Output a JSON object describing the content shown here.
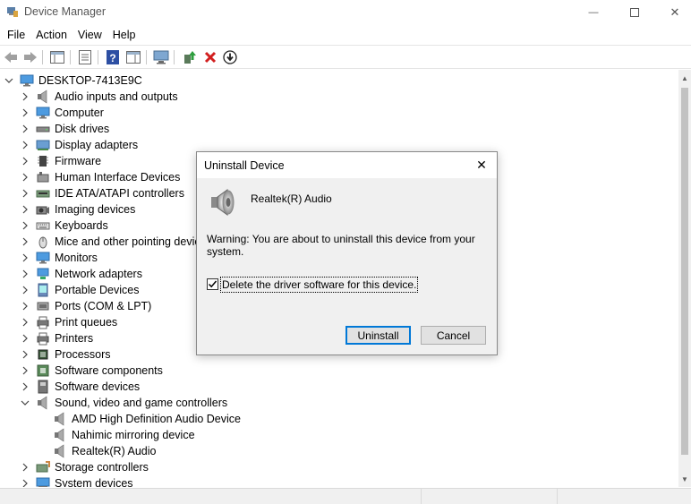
{
  "window": {
    "title": "Device Manager",
    "min_glyph": "—",
    "close_glyph": "✕"
  },
  "menu": [
    "File",
    "Action",
    "View",
    "Help"
  ],
  "tree": {
    "root": "DESKTOP-7413E9C",
    "categories": [
      {
        "label": "Audio inputs and outputs",
        "icon": "speaker-icon",
        "expanded": false
      },
      {
        "label": "Computer",
        "icon": "monitor-icon",
        "expanded": false
      },
      {
        "label": "Disk drives",
        "icon": "disk-icon",
        "expanded": false
      },
      {
        "label": "Display adapters",
        "icon": "display-adapter-icon",
        "expanded": false
      },
      {
        "label": "Firmware",
        "icon": "chip-icon",
        "expanded": false
      },
      {
        "label": "Human Interface Devices",
        "icon": "hid-icon",
        "expanded": false
      },
      {
        "label": "IDE ATA/ATAPI controllers",
        "icon": "ide-icon",
        "expanded": false
      },
      {
        "label": "Imaging devices",
        "icon": "camera-icon",
        "expanded": false
      },
      {
        "label": "Keyboards",
        "icon": "keyboard-icon",
        "expanded": false
      },
      {
        "label": "Mice and other pointing devices",
        "icon": "mouse-icon",
        "expanded": false
      },
      {
        "label": "Monitors",
        "icon": "monitor-icon",
        "expanded": false
      },
      {
        "label": "Network adapters",
        "icon": "network-icon",
        "expanded": false
      },
      {
        "label": "Portable Devices",
        "icon": "portable-icon",
        "expanded": false
      },
      {
        "label": "Ports (COM & LPT)",
        "icon": "port-icon",
        "expanded": false
      },
      {
        "label": "Print queues",
        "icon": "printer-icon",
        "expanded": false
      },
      {
        "label": "Printers",
        "icon": "printer-icon",
        "expanded": false
      },
      {
        "label": "Processors",
        "icon": "processor-icon",
        "expanded": false
      },
      {
        "label": "Software components",
        "icon": "software-icon",
        "expanded": false
      },
      {
        "label": "Software devices",
        "icon": "software-device-icon",
        "expanded": false
      },
      {
        "label": "Sound, video and game controllers",
        "icon": "speaker-icon",
        "expanded": true,
        "children": [
          "AMD High Definition Audio Device",
          "Nahimic mirroring device",
          "Realtek(R) Audio"
        ]
      },
      {
        "label": "Storage controllers",
        "icon": "storage-icon",
        "expanded": false
      },
      {
        "label": "System devices",
        "icon": "system-icon",
        "expanded": false
      }
    ]
  },
  "dialog": {
    "title": "Uninstall Device",
    "device_name": "Realtek(R) Audio",
    "warning": "Warning: You are about to uninstall this device from your system.",
    "checkbox_label": "Delete the driver software for this device.",
    "checkbox_checked": true,
    "uninstall_label": "Uninstall",
    "cancel_label": "Cancel",
    "close_glyph": "✕"
  }
}
